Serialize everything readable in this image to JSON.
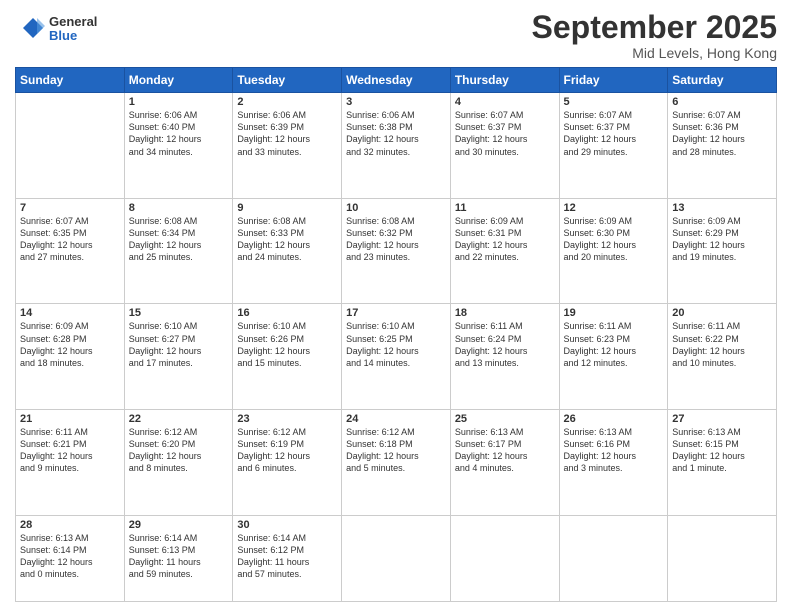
{
  "header": {
    "logo": {
      "general": "General",
      "blue": "Blue"
    },
    "title": "September 2025",
    "location": "Mid Levels, Hong Kong"
  },
  "weekdays": [
    "Sunday",
    "Monday",
    "Tuesday",
    "Wednesday",
    "Thursday",
    "Friday",
    "Saturday"
  ],
  "weeks": [
    [
      {
        "day": "",
        "info": ""
      },
      {
        "day": "1",
        "info": "Sunrise: 6:06 AM\nSunset: 6:40 PM\nDaylight: 12 hours\nand 34 minutes."
      },
      {
        "day": "2",
        "info": "Sunrise: 6:06 AM\nSunset: 6:39 PM\nDaylight: 12 hours\nand 33 minutes."
      },
      {
        "day": "3",
        "info": "Sunrise: 6:06 AM\nSunset: 6:38 PM\nDaylight: 12 hours\nand 32 minutes."
      },
      {
        "day": "4",
        "info": "Sunrise: 6:07 AM\nSunset: 6:37 PM\nDaylight: 12 hours\nand 30 minutes."
      },
      {
        "day": "5",
        "info": "Sunrise: 6:07 AM\nSunset: 6:37 PM\nDaylight: 12 hours\nand 29 minutes."
      },
      {
        "day": "6",
        "info": "Sunrise: 6:07 AM\nSunset: 6:36 PM\nDaylight: 12 hours\nand 28 minutes."
      }
    ],
    [
      {
        "day": "7",
        "info": "Sunrise: 6:07 AM\nSunset: 6:35 PM\nDaylight: 12 hours\nand 27 minutes."
      },
      {
        "day": "8",
        "info": "Sunrise: 6:08 AM\nSunset: 6:34 PM\nDaylight: 12 hours\nand 25 minutes."
      },
      {
        "day": "9",
        "info": "Sunrise: 6:08 AM\nSunset: 6:33 PM\nDaylight: 12 hours\nand 24 minutes."
      },
      {
        "day": "10",
        "info": "Sunrise: 6:08 AM\nSunset: 6:32 PM\nDaylight: 12 hours\nand 23 minutes."
      },
      {
        "day": "11",
        "info": "Sunrise: 6:09 AM\nSunset: 6:31 PM\nDaylight: 12 hours\nand 22 minutes."
      },
      {
        "day": "12",
        "info": "Sunrise: 6:09 AM\nSunset: 6:30 PM\nDaylight: 12 hours\nand 20 minutes."
      },
      {
        "day": "13",
        "info": "Sunrise: 6:09 AM\nSunset: 6:29 PM\nDaylight: 12 hours\nand 19 minutes."
      }
    ],
    [
      {
        "day": "14",
        "info": "Sunrise: 6:09 AM\nSunset: 6:28 PM\nDaylight: 12 hours\nand 18 minutes."
      },
      {
        "day": "15",
        "info": "Sunrise: 6:10 AM\nSunset: 6:27 PM\nDaylight: 12 hours\nand 17 minutes."
      },
      {
        "day": "16",
        "info": "Sunrise: 6:10 AM\nSunset: 6:26 PM\nDaylight: 12 hours\nand 15 minutes."
      },
      {
        "day": "17",
        "info": "Sunrise: 6:10 AM\nSunset: 6:25 PM\nDaylight: 12 hours\nand 14 minutes."
      },
      {
        "day": "18",
        "info": "Sunrise: 6:11 AM\nSunset: 6:24 PM\nDaylight: 12 hours\nand 13 minutes."
      },
      {
        "day": "19",
        "info": "Sunrise: 6:11 AM\nSunset: 6:23 PM\nDaylight: 12 hours\nand 12 minutes."
      },
      {
        "day": "20",
        "info": "Sunrise: 6:11 AM\nSunset: 6:22 PM\nDaylight: 12 hours\nand 10 minutes."
      }
    ],
    [
      {
        "day": "21",
        "info": "Sunrise: 6:11 AM\nSunset: 6:21 PM\nDaylight: 12 hours\nand 9 minutes."
      },
      {
        "day": "22",
        "info": "Sunrise: 6:12 AM\nSunset: 6:20 PM\nDaylight: 12 hours\nand 8 minutes."
      },
      {
        "day": "23",
        "info": "Sunrise: 6:12 AM\nSunset: 6:19 PM\nDaylight: 12 hours\nand 6 minutes."
      },
      {
        "day": "24",
        "info": "Sunrise: 6:12 AM\nSunset: 6:18 PM\nDaylight: 12 hours\nand 5 minutes."
      },
      {
        "day": "25",
        "info": "Sunrise: 6:13 AM\nSunset: 6:17 PM\nDaylight: 12 hours\nand 4 minutes."
      },
      {
        "day": "26",
        "info": "Sunrise: 6:13 AM\nSunset: 6:16 PM\nDaylight: 12 hours\nand 3 minutes."
      },
      {
        "day": "27",
        "info": "Sunrise: 6:13 AM\nSunset: 6:15 PM\nDaylight: 12 hours\nand 1 minute."
      }
    ],
    [
      {
        "day": "28",
        "info": "Sunrise: 6:13 AM\nSunset: 6:14 PM\nDaylight: 12 hours\nand 0 minutes."
      },
      {
        "day": "29",
        "info": "Sunrise: 6:14 AM\nSunset: 6:13 PM\nDaylight: 11 hours\nand 59 minutes."
      },
      {
        "day": "30",
        "info": "Sunrise: 6:14 AM\nSunset: 6:12 PM\nDaylight: 11 hours\nand 57 minutes."
      },
      {
        "day": "",
        "info": ""
      },
      {
        "day": "",
        "info": ""
      },
      {
        "day": "",
        "info": ""
      },
      {
        "day": "",
        "info": ""
      }
    ]
  ]
}
